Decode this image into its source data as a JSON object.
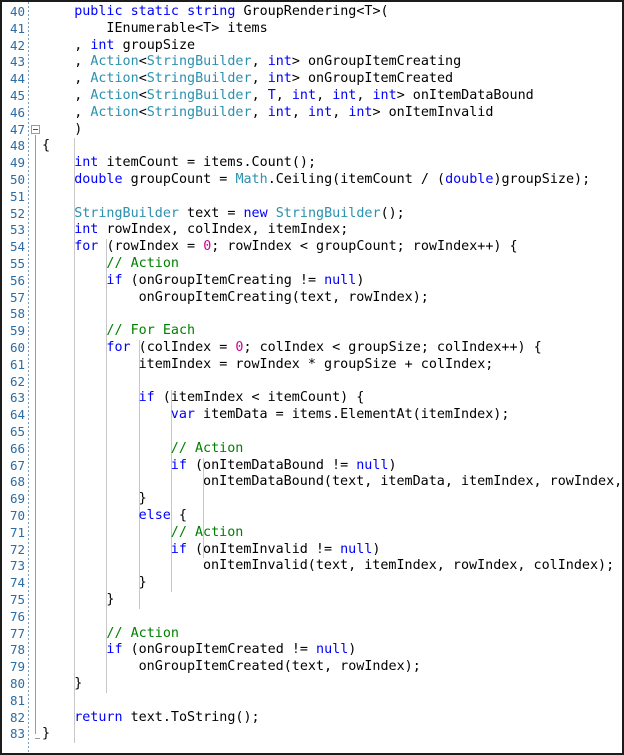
{
  "editor": {
    "language": "C#",
    "first_line": 40,
    "last_line": 83,
    "colors": {
      "background": "#ffffff",
      "border": "#1c1c1c",
      "line_number": "#2b6ca3",
      "keyword": "#0000ff",
      "type": "#2b91af",
      "comment": "#008000",
      "number": "#d10092",
      "plain": "#000000",
      "indent_guide": "#c8c8c8",
      "fold_marker": "#9a9a9a"
    },
    "fold_markers": [
      {
        "line": 47,
        "kind": "collapse-box"
      },
      {
        "line": 83,
        "kind": "fold-end-elbow"
      }
    ],
    "lines": [
      {
        "n": 40,
        "indent": 1,
        "tokens": [
          {
            "t": "public ",
            "c": "kw"
          },
          {
            "t": "static ",
            "c": "kw"
          },
          {
            "t": "string ",
            "c": "kw"
          },
          {
            "t": "GroupRendering<T>(",
            "c": "pl"
          }
        ]
      },
      {
        "n": 41,
        "indent": 2,
        "tokens": [
          {
            "t": "IEnumerable<T> items",
            "c": "pl"
          }
        ]
      },
      {
        "n": 42,
        "indent": 1,
        "tokens": [
          {
            "t": ", ",
            "c": "pl"
          },
          {
            "t": "int ",
            "c": "kw"
          },
          {
            "t": "groupSize",
            "c": "pl"
          }
        ]
      },
      {
        "n": 43,
        "indent": 1,
        "tokens": [
          {
            "t": ", ",
            "c": "pl"
          },
          {
            "t": "Action",
            "c": "ty"
          },
          {
            "t": "<",
            "c": "pl"
          },
          {
            "t": "StringBuilder",
            "c": "ty"
          },
          {
            "t": ", ",
            "c": "pl"
          },
          {
            "t": "int",
            "c": "kw"
          },
          {
            "t": "> onGroupItemCreating",
            "c": "pl"
          }
        ]
      },
      {
        "n": 44,
        "indent": 1,
        "tokens": [
          {
            "t": ", ",
            "c": "pl"
          },
          {
            "t": "Action",
            "c": "ty"
          },
          {
            "t": "<",
            "c": "pl"
          },
          {
            "t": "StringBuilder",
            "c": "ty"
          },
          {
            "t": ", ",
            "c": "pl"
          },
          {
            "t": "int",
            "c": "kw"
          },
          {
            "t": "> onGroupItemCreated",
            "c": "pl"
          }
        ]
      },
      {
        "n": 45,
        "indent": 1,
        "tokens": [
          {
            "t": ", ",
            "c": "pl"
          },
          {
            "t": "Action",
            "c": "ty"
          },
          {
            "t": "<",
            "c": "pl"
          },
          {
            "t": "StringBuilder",
            "c": "ty"
          },
          {
            "t": ", ",
            "c": "pl"
          },
          {
            "t": "T",
            "c": "kw"
          },
          {
            "t": ", ",
            "c": "pl"
          },
          {
            "t": "int",
            "c": "kw"
          },
          {
            "t": ", ",
            "c": "pl"
          },
          {
            "t": "int",
            "c": "kw"
          },
          {
            "t": ", ",
            "c": "pl"
          },
          {
            "t": "int",
            "c": "kw"
          },
          {
            "t": "> onItemDataBound",
            "c": "pl"
          }
        ]
      },
      {
        "n": 46,
        "indent": 1,
        "tokens": [
          {
            "t": ", ",
            "c": "pl"
          },
          {
            "t": "Action",
            "c": "ty"
          },
          {
            "t": "<",
            "c": "pl"
          },
          {
            "t": "StringBuilder",
            "c": "ty"
          },
          {
            "t": ", ",
            "c": "pl"
          },
          {
            "t": "int",
            "c": "kw"
          },
          {
            "t": ", ",
            "c": "pl"
          },
          {
            "t": "int",
            "c": "kw"
          },
          {
            "t": ", ",
            "c": "pl"
          },
          {
            "t": "int",
            "c": "kw"
          },
          {
            "t": "> onItemInvalid",
            "c": "pl"
          }
        ]
      },
      {
        "n": 47,
        "indent": 1,
        "tokens": [
          {
            "t": ")",
            "c": "pl"
          }
        ]
      },
      {
        "n": 48,
        "indent": 0,
        "tokens": [
          {
            "t": "{",
            "c": "pl"
          }
        ]
      },
      {
        "n": 49,
        "indent": 1,
        "tokens": [
          {
            "t": "int ",
            "c": "kw"
          },
          {
            "t": "itemCount = items.Count();",
            "c": "pl"
          }
        ]
      },
      {
        "n": 50,
        "indent": 1,
        "tokens": [
          {
            "t": "double ",
            "c": "kw"
          },
          {
            "t": "groupCount = ",
            "c": "pl"
          },
          {
            "t": "Math",
            "c": "ty"
          },
          {
            "t": ".Ceiling(itemCount / (",
            "c": "pl"
          },
          {
            "t": "double",
            "c": "kw"
          },
          {
            "t": ")groupSize);",
            "c": "pl"
          }
        ]
      },
      {
        "n": 51,
        "indent": 1,
        "tokens": []
      },
      {
        "n": 52,
        "indent": 1,
        "tokens": [
          {
            "t": "StringBuilder",
            "c": "ty"
          },
          {
            "t": " text = ",
            "c": "pl"
          },
          {
            "t": "new ",
            "c": "kw"
          },
          {
            "t": "StringBuilder",
            "c": "ty"
          },
          {
            "t": "();",
            "c": "pl"
          }
        ]
      },
      {
        "n": 53,
        "indent": 1,
        "tokens": [
          {
            "t": "int ",
            "c": "kw"
          },
          {
            "t": "rowIndex, colIndex, itemIndex;",
            "c": "pl"
          }
        ]
      },
      {
        "n": 54,
        "indent": 1,
        "tokens": [
          {
            "t": "for ",
            "c": "kw"
          },
          {
            "t": "(rowIndex = ",
            "c": "pl"
          },
          {
            "t": "0",
            "c": "nm"
          },
          {
            "t": "; rowIndex < groupCount; rowIndex++) {",
            "c": "pl"
          }
        ]
      },
      {
        "n": 55,
        "indent": 2,
        "tokens": [
          {
            "t": "// Action",
            "c": "cm"
          }
        ]
      },
      {
        "n": 56,
        "indent": 2,
        "tokens": [
          {
            "t": "if ",
            "c": "kw"
          },
          {
            "t": "(onGroupItemCreating != ",
            "c": "pl"
          },
          {
            "t": "null",
            "c": "kw"
          },
          {
            "t": ")",
            "c": "pl"
          }
        ]
      },
      {
        "n": 57,
        "indent": 3,
        "tokens": [
          {
            "t": "onGroupItemCreating(text, rowIndex);",
            "c": "pl"
          }
        ]
      },
      {
        "n": 58,
        "indent": 2,
        "tokens": []
      },
      {
        "n": 59,
        "indent": 2,
        "tokens": [
          {
            "t": "// For Each",
            "c": "cm"
          }
        ]
      },
      {
        "n": 60,
        "indent": 2,
        "tokens": [
          {
            "t": "for ",
            "c": "kw"
          },
          {
            "t": "(colIndex = ",
            "c": "pl"
          },
          {
            "t": "0",
            "c": "nm"
          },
          {
            "t": "; colIndex < groupSize; colIndex++) {",
            "c": "pl"
          }
        ]
      },
      {
        "n": 61,
        "indent": 3,
        "tokens": [
          {
            "t": "itemIndex = rowIndex * groupSize + colIndex;",
            "c": "pl"
          }
        ]
      },
      {
        "n": 62,
        "indent": 3,
        "tokens": []
      },
      {
        "n": 63,
        "indent": 3,
        "tokens": [
          {
            "t": "if ",
            "c": "kw"
          },
          {
            "t": "(itemIndex < itemCount) {",
            "c": "pl"
          }
        ]
      },
      {
        "n": 64,
        "indent": 4,
        "tokens": [
          {
            "t": "var ",
            "c": "kw"
          },
          {
            "t": "itemData = items.ElementAt(itemIndex);",
            "c": "pl"
          }
        ]
      },
      {
        "n": 65,
        "indent": 4,
        "tokens": []
      },
      {
        "n": 66,
        "indent": 4,
        "tokens": [
          {
            "t": "// Action",
            "c": "cm"
          }
        ]
      },
      {
        "n": 67,
        "indent": 4,
        "tokens": [
          {
            "t": "if ",
            "c": "kw"
          },
          {
            "t": "(onItemDataBound != ",
            "c": "pl"
          },
          {
            "t": "null",
            "c": "kw"
          },
          {
            "t": ")",
            "c": "pl"
          }
        ]
      },
      {
        "n": 68,
        "indent": 5,
        "tokens": [
          {
            "t": "onItemDataBound(text, itemData, itemIndex, rowIndex, colIndex);",
            "c": "pl"
          }
        ]
      },
      {
        "n": 69,
        "indent": 3,
        "tokens": [
          {
            "t": "}",
            "c": "pl"
          }
        ]
      },
      {
        "n": 70,
        "indent": 3,
        "tokens": [
          {
            "t": "else ",
            "c": "kw"
          },
          {
            "t": "{",
            "c": "pl"
          }
        ]
      },
      {
        "n": 71,
        "indent": 4,
        "tokens": [
          {
            "t": "// Action",
            "c": "cm"
          }
        ]
      },
      {
        "n": 72,
        "indent": 4,
        "tokens": [
          {
            "t": "if ",
            "c": "kw"
          },
          {
            "t": "(onItemInvalid != ",
            "c": "pl"
          },
          {
            "t": "null",
            "c": "kw"
          },
          {
            "t": ")",
            "c": "pl"
          }
        ]
      },
      {
        "n": 73,
        "indent": 5,
        "tokens": [
          {
            "t": "onItemInvalid(text, itemIndex, rowIndex, colIndex);",
            "c": "pl"
          }
        ]
      },
      {
        "n": 74,
        "indent": 3,
        "tokens": [
          {
            "t": "}",
            "c": "pl"
          }
        ]
      },
      {
        "n": 75,
        "indent": 2,
        "tokens": [
          {
            "t": "}",
            "c": "pl"
          }
        ]
      },
      {
        "n": 76,
        "indent": 2,
        "tokens": []
      },
      {
        "n": 77,
        "indent": 2,
        "tokens": [
          {
            "t": "// Action",
            "c": "cm"
          }
        ]
      },
      {
        "n": 78,
        "indent": 2,
        "tokens": [
          {
            "t": "if ",
            "c": "kw"
          },
          {
            "t": "(onGroupItemCreated != ",
            "c": "pl"
          },
          {
            "t": "null",
            "c": "kw"
          },
          {
            "t": ")",
            "c": "pl"
          }
        ]
      },
      {
        "n": 79,
        "indent": 3,
        "tokens": [
          {
            "t": "onGroupItemCreated(text, rowIndex);",
            "c": "pl"
          }
        ]
      },
      {
        "n": 80,
        "indent": 1,
        "tokens": [
          {
            "t": "}",
            "c": "pl"
          }
        ]
      },
      {
        "n": 81,
        "indent": 1,
        "tokens": []
      },
      {
        "n": 82,
        "indent": 1,
        "tokens": [
          {
            "t": "return ",
            "c": "kw"
          },
          {
            "t": "text.ToString();",
            "c": "pl"
          }
        ]
      },
      {
        "n": 83,
        "indent": 0,
        "tokens": [
          {
            "t": "}",
            "c": "pl"
          }
        ]
      }
    ],
    "indent_guide_lines": [
      {
        "level": 1,
        "from": 48,
        "to": 83
      },
      {
        "level": 2,
        "from": 54,
        "to": 80
      },
      {
        "level": 3,
        "from": 60,
        "to": 75
      },
      {
        "level": 4,
        "from": 63,
        "to": 74
      },
      {
        "level": 5,
        "from": 67,
        "to": 72
      }
    ]
  }
}
